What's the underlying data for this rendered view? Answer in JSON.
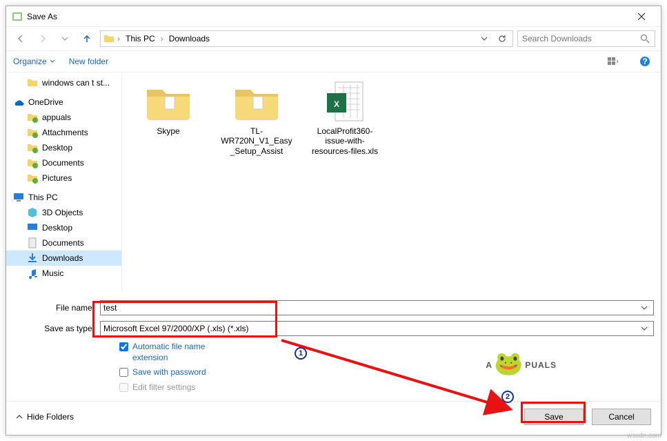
{
  "titlebar": {
    "title": "Save As"
  },
  "nav": {
    "crumbs": [
      "This PC",
      "Downloads"
    ],
    "search_placeholder": "Search Downloads"
  },
  "toolbar": {
    "organize": "Organize",
    "newfolder": "New folder"
  },
  "sidebar": {
    "recent_item": "windows can t st...",
    "onedrive": "OneDrive",
    "onedrive_children": [
      "appuals",
      "Attachments",
      "Desktop",
      "Documents",
      "Pictures"
    ],
    "thispc": "This PC",
    "thispc_children": [
      "3D Objects",
      "Desktop",
      "Documents",
      "Downloads",
      "Music"
    ]
  },
  "files": [
    {
      "name": "Skype",
      "type": "folder"
    },
    {
      "name": "TL-WR720N_V1_Easy_Setup_Assist",
      "type": "folder"
    },
    {
      "name": "LocalProfit360-issue-with-resources-files.xls",
      "type": "xls"
    }
  ],
  "form": {
    "filename_label": "File name:",
    "filename_value": "test",
    "saveastype_label": "Save as type:",
    "saveastype_value": "Microsoft Excel 97/2000/XP (.xls) (*.xls)",
    "auto_extension": "Automatic file name extension",
    "save_password": "Save with password",
    "edit_filter": "Edit filter settings"
  },
  "buttons": {
    "hide_folders": "Hide Folders",
    "save": "Save",
    "cancel": "Cancel"
  },
  "annotations": {
    "n1": "1",
    "n2": "2"
  },
  "watermark": {
    "logo": "A🐸PUALS",
    "src": "wsxdn.com"
  }
}
